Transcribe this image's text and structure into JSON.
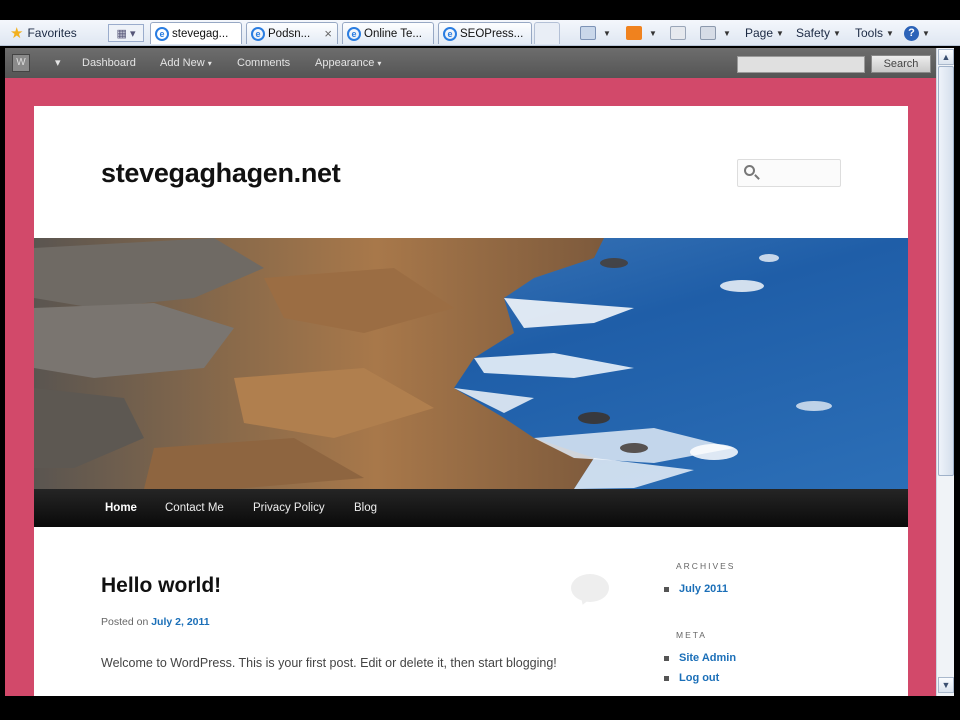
{
  "ie": {
    "favorites_label": "Favorites",
    "tabs": [
      {
        "label": "stevegag..."
      },
      {
        "label": "Podsn..."
      },
      {
        "label": "Online Te..."
      },
      {
        "label": "SEOPress..."
      }
    ],
    "close_glyph": "×",
    "commands": {
      "page": "Page",
      "safety": "Safety",
      "tools": "Tools",
      "help": "?"
    }
  },
  "admin_bar": {
    "items": [
      {
        "label": "Dashboard"
      },
      {
        "label": "Add New"
      },
      {
        "label": "Comments"
      },
      {
        "label": "Appearance"
      }
    ],
    "search_value": "",
    "search_button": "Search"
  },
  "site": {
    "title": "stevegaghagen.net",
    "search_value": ""
  },
  "nav": {
    "items": [
      {
        "label": "Home"
      },
      {
        "label": "Contact Me"
      },
      {
        "label": "Privacy Policy"
      },
      {
        "label": "Blog"
      }
    ]
  },
  "post": {
    "title": "Hello world!",
    "meta_prefix": "Posted on",
    "date": "July 2, 2011",
    "body": "Welcome to WordPress. This is your first post. Edit or delete it, then start blogging!"
  },
  "sidebar": {
    "archives_title": "ARCHIVES",
    "archives": [
      {
        "label": "July 2011"
      }
    ],
    "meta_title": "META",
    "meta": [
      {
        "label": "Site Admin"
      },
      {
        "label": "Log out"
      }
    ]
  },
  "colors": {
    "page_background": "#d2496a",
    "nav_background": "#111111",
    "link": "#1b6fb8"
  }
}
